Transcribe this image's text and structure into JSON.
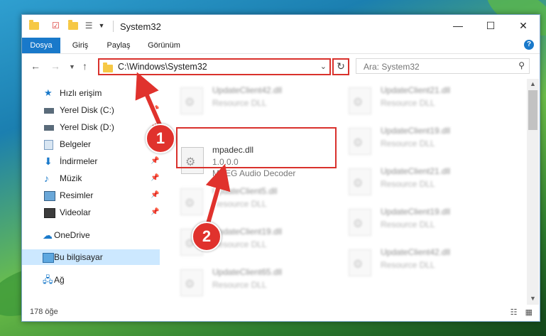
{
  "window": {
    "title": "System32"
  },
  "ribbon": {
    "tabs": [
      "Dosya",
      "Giriş",
      "Paylaş",
      "Görünüm"
    ],
    "help": "?"
  },
  "nav": {
    "address": "C:\\Windows\\System32",
    "search_placeholder": "Ara: System32"
  },
  "sidebar": {
    "items": [
      {
        "label": "Hızlı erişim"
      },
      {
        "label": "Yerel Disk (C:)"
      },
      {
        "label": "Yerel Disk (D:)"
      },
      {
        "label": "Belgeler"
      },
      {
        "label": "İndirmeler"
      },
      {
        "label": "Müzik"
      },
      {
        "label": "Resimler"
      },
      {
        "label": "Videolar"
      },
      {
        "label": "OneDrive"
      },
      {
        "label": "Bu bilgisayar"
      },
      {
        "label": "Ağ"
      }
    ]
  },
  "files": {
    "left_column": [
      {
        "name": "UpdateClient42.dll",
        "desc": "Resource DLL"
      },
      {
        "name": "mpadec.dll",
        "version": "1.0.0.0",
        "desc": "MPEG Audio Decoder"
      },
      {
        "name": "UpdateClient5.dll",
        "desc": "Resource DLL"
      },
      {
        "name": "UpdateClient19.dll",
        "desc": "Resource DLL"
      },
      {
        "name": "UpdateClient65.dll",
        "desc": "Resource DLL"
      }
    ],
    "right_column": [
      {
        "name": "UpdateClient21.dll",
        "desc": "Resource DLL"
      },
      {
        "name": "UpdateClient19.dll",
        "desc": "Resource DLL"
      },
      {
        "name": "UpdateClient21.dll",
        "desc": "Resource DLL"
      },
      {
        "name": "UpdateClient19.dll",
        "desc": "Resource DLL"
      },
      {
        "name": "UpdateClient42.dll",
        "desc": "Resource DLL"
      }
    ]
  },
  "status": {
    "count": "178 öğe"
  },
  "callouts": [
    "1",
    "2"
  ],
  "colors": {
    "accent": "#1979ca",
    "highlight": "#d9312c",
    "selected": "#cce8ff"
  }
}
